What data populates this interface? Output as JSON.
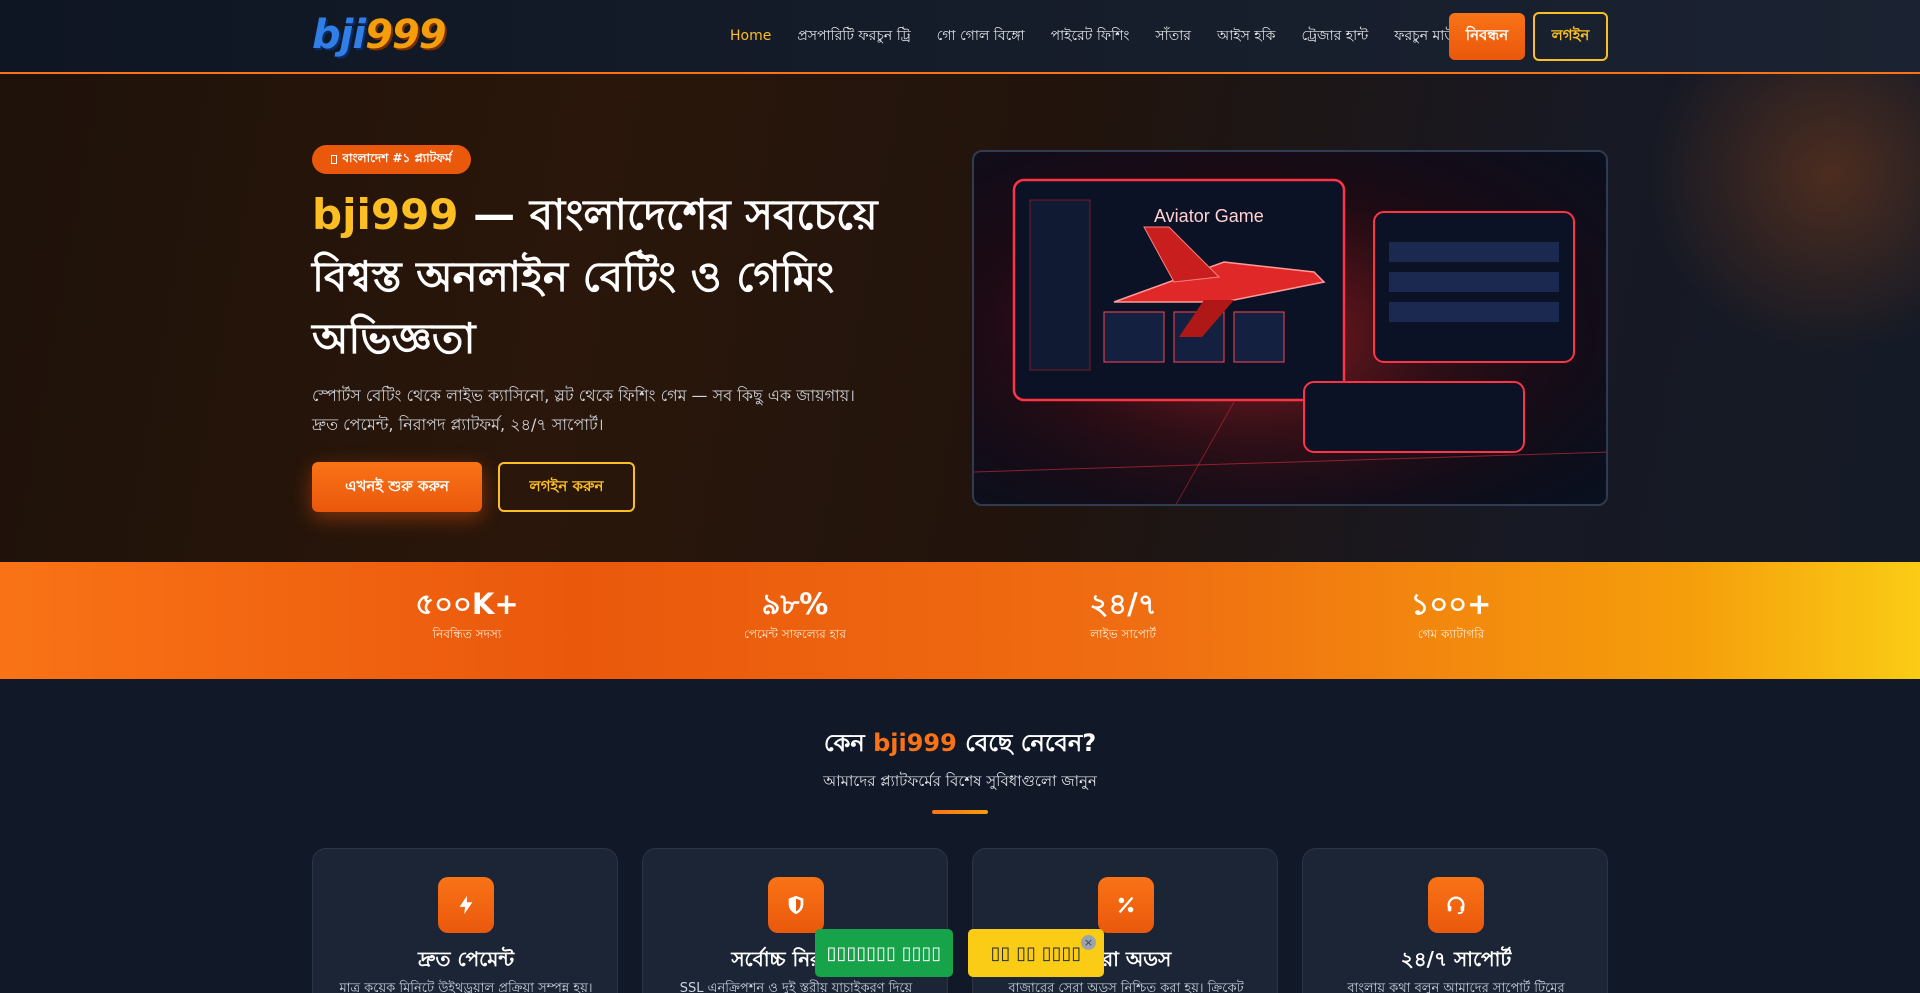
{
  "brand": {
    "logo_part1": "bji",
    "logo_part2": "999"
  },
  "nav": {
    "links": [
      "Home",
      "প্রসপারিটি ফরচুন ট্রি",
      "গো গোল বিঙ্গো",
      "পাইরেট ফিশিং",
      "সাঁতার",
      "আইস হকি",
      "ট্রেজার হান্ট",
      "ফরচুন মাউস"
    ],
    "active": "Home",
    "register_label": "নিবন্ধন",
    "login_label": "লগইন"
  },
  "hero": {
    "badge_icon": "fire-icon",
    "badge_text": "বাংলাদেশ #১ প্ল্যাটফর্ম",
    "title_brand": "bji999",
    "title_rest": " — বাংলাদেশের সবচেয়ে বিশ্বস্ত অনলাইন বেটিং ও গেমিং অভিজ্ঞতা",
    "description": "স্পোর্টস বেটিং থেকে লাইভ ক্যাসিনো, স্লট থেকে ফিশিং গেম — সব কিছু এক জায়গায়। দ্রুত পেমেন্ট, নিরাপদ প্ল্যাটফর্ম, ২৪/৭ সাপোর্ট।",
    "cta_primary": "এখনই শুরু করুন",
    "cta_secondary": "লগইন করুন",
    "image_caption": "Aviator Game"
  },
  "stats": [
    {
      "value": "৫০০K+",
      "label": "নিবন্ধিত সদস্য"
    },
    {
      "value": "৯৮%",
      "label": "পেমেন্ট সাফল্যের হার"
    },
    {
      "value": "২৪/৭",
      "label": "লাইভ সাপোর্ট"
    },
    {
      "value": "১০০+",
      "label": "গেম ক্যাটাগরি"
    }
  ],
  "features": {
    "title_pre": "কেন ",
    "title_brand": "bji999",
    "title_post": " বেছে নেবেন?",
    "subtitle": "আমাদের প্ল্যাটফর্মের বিশেষ সুবিধাগুলো জানুন",
    "cards": [
      {
        "icon": "lightning-icon",
        "title": "দ্রুত পেমেন্ট",
        "desc": "মাত্র কয়েক মিনিটে উইথড্রয়াল প্রক্রিয়া সম্পন্ন হয়।"
      },
      {
        "icon": "shield-icon",
        "title": "সর্বোচ্চ নিরাপত্তা",
        "desc": "SSL এনক্রিপশন ও দুই স্তরীয় যাচাইকরণ দিয়ে"
      },
      {
        "icon": "percent-icon",
        "title": "সেরা অডস",
        "desc": "বাজারের সেরা অডস নিশ্চিত করা হয়। ক্রিকেট"
      },
      {
        "icon": "headset-icon",
        "title": "২৪/৭ সাপোর্ট",
        "desc": "বাংলায় কথা বলুন আমাদের সাপোর্ট টিমের"
      }
    ]
  },
  "floating": {
    "green_label": "▯▯▯▯▯▯▯ ▯▯▯▯",
    "yellow_label": "▯▯ ▯▯ ▯▯▯▯",
    "close_icon": "close-icon"
  },
  "colors": {
    "accent": "#f97316",
    "accent_dark": "#ea580c",
    "gold": "#fbbf24",
    "background": "#111827",
    "card": "#1c2535",
    "float_green": "#16a34a",
    "float_yellow": "#facc15"
  }
}
